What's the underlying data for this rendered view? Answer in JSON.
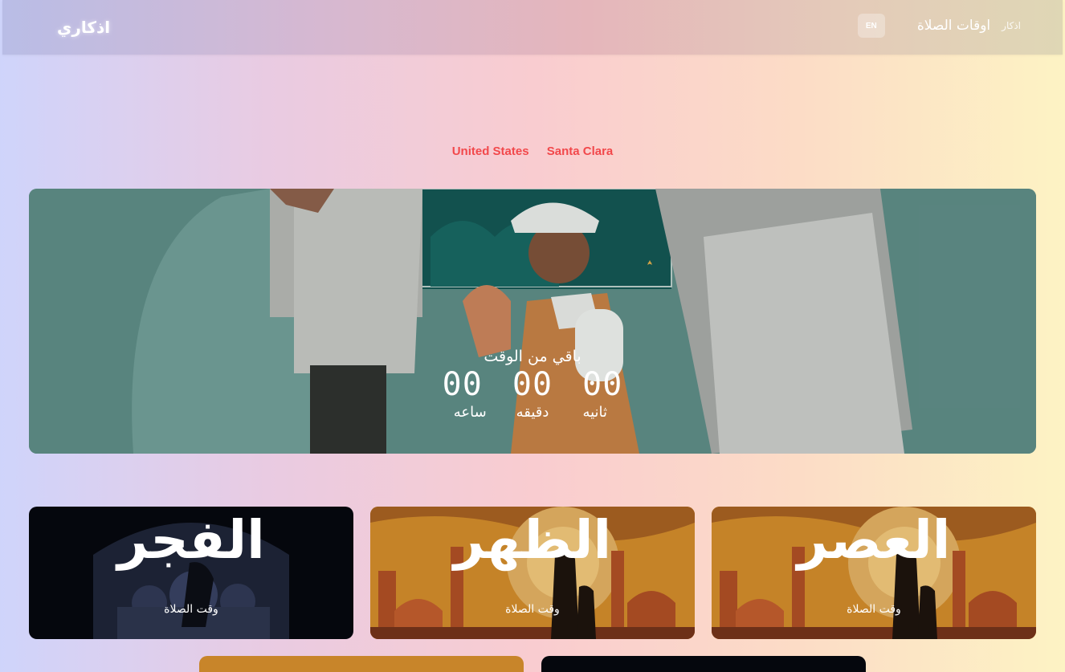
{
  "navbar": {
    "brand": "اذكاري",
    "lang_button": "EN",
    "prayer_times_link": "اوقات الصلاة",
    "adhkar_link": "اذكار"
  },
  "location": {
    "country": "United States",
    "city": "Santa Clara"
  },
  "countdown": {
    "title": "باقي من الوقت",
    "hours": "00",
    "minutes": "00",
    "seconds": "00",
    "hours_label": "ساعه",
    "minutes_label": "دقيقه",
    "seconds_label": "ثانيه"
  },
  "prayer_cards": [
    {
      "name": "الفجر",
      "subtitle": "وقت الصلاة"
    },
    {
      "name": "الظهر",
      "subtitle": "وقت الصلاة"
    },
    {
      "name": "العصر",
      "subtitle": "وقت الصلاة"
    }
  ],
  "colors": {
    "location_text": "#f2484b",
    "fajr_bg": "#06080f",
    "dhuhr_bg": "#c8852a",
    "asr_bg": "#c8852a"
  }
}
